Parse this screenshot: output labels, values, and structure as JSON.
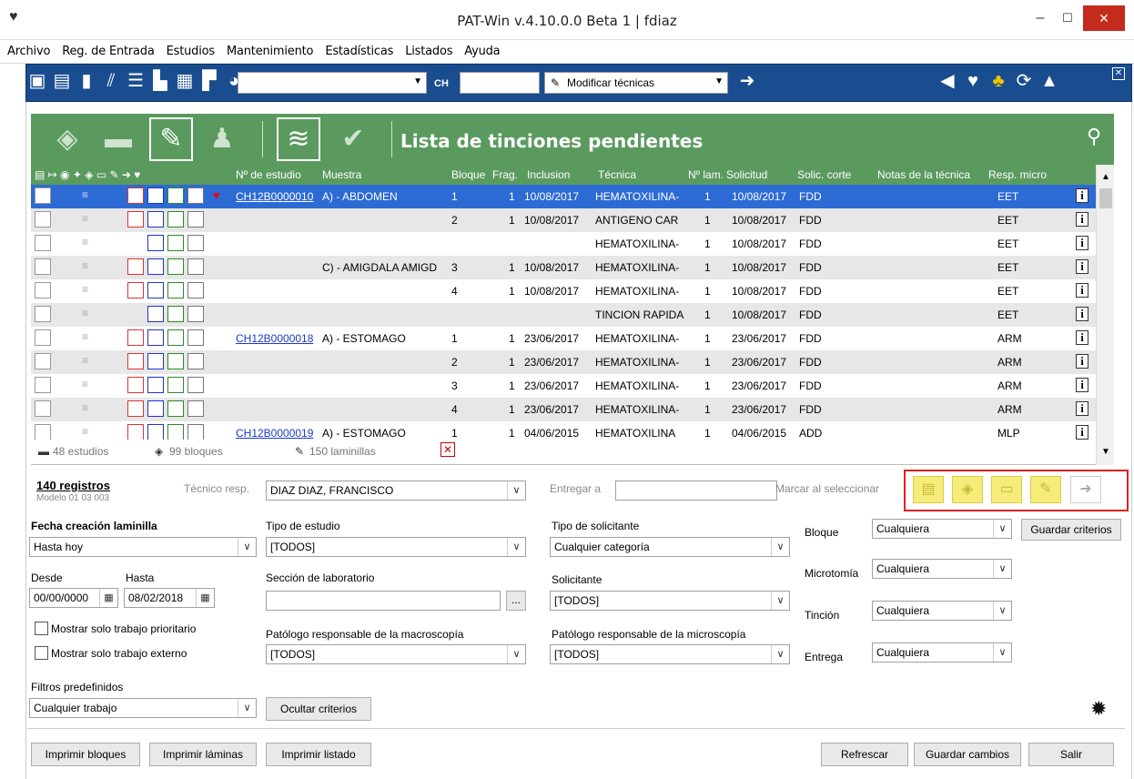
{
  "window": {
    "title": "PAT-Win v.4.10.0.0 Beta 1 | fdiaz",
    "minimize": "–",
    "maximize": "☐",
    "close": "✕"
  },
  "menu": [
    "Archivo",
    "Reg. de Entrada",
    "Estudios",
    "Mantenimiento",
    "Estadísticas",
    "Listados",
    "Ayuda"
  ],
  "toolbar": {
    "ch_label": "CH",
    "action_select": "Modificar técnicas"
  },
  "header": {
    "title": "Lista de tinciones pendientes"
  },
  "grid": {
    "columns": [
      "Nº de estudio",
      "Muestra",
      "Bloque",
      "Frag.",
      "Inclusion",
      "Técnica",
      "Nº lam.",
      "Solicitud",
      "Solic. corte",
      "Notas de la técnica",
      "Resp. micro"
    ],
    "rows": [
      {
        "estudio": "CH12B0000010",
        "muestra": "A) - ABDOMEN",
        "bloque": "1",
        "frag": "1",
        "inclusion": "10/08/2017",
        "tecnica": "HEMATOXILINA-",
        "lam": "1",
        "solicitud": "10/08/2017",
        "corte": "FDD",
        "resp": "EET"
      },
      {
        "estudio": "",
        "muestra": "",
        "bloque": "2",
        "frag": "1",
        "inclusion": "10/08/2017",
        "tecnica": "ANTIGENO CAR",
        "lam": "1",
        "solicitud": "10/08/2017",
        "corte": "FDD",
        "resp": "EET"
      },
      {
        "estudio": "",
        "muestra": "",
        "bloque": "",
        "frag": "",
        "inclusion": "",
        "tecnica": "HEMATOXILINA-",
        "lam": "1",
        "solicitud": "10/08/2017",
        "corte": "FDD",
        "resp": "EET"
      },
      {
        "estudio": "",
        "muestra": "C) - AMIGDALA AMIGD",
        "bloque": "3",
        "frag": "1",
        "inclusion": "10/08/2017",
        "tecnica": "HEMATOXILINA-",
        "lam": "1",
        "solicitud": "10/08/2017",
        "corte": "FDD",
        "resp": "EET"
      },
      {
        "estudio": "",
        "muestra": "",
        "bloque": "4",
        "frag": "1",
        "inclusion": "10/08/2017",
        "tecnica": "HEMATOXILINA-",
        "lam": "1",
        "solicitud": "10/08/2017",
        "corte": "FDD",
        "resp": "EET"
      },
      {
        "estudio": "",
        "muestra": "",
        "bloque": "",
        "frag": "",
        "inclusion": "",
        "tecnica": "TINCION RAPIDA",
        "lam": "1",
        "solicitud": "10/08/2017",
        "corte": "FDD",
        "resp": "EET"
      },
      {
        "estudio": "CH12B0000018",
        "muestra": "A) - ESTOMAGO",
        "bloque": "1",
        "frag": "1",
        "inclusion": "23/06/2017",
        "tecnica": "HEMATOXILINA-",
        "lam": "1",
        "solicitud": "23/06/2017",
        "corte": "FDD",
        "resp": "ARM"
      },
      {
        "estudio": "",
        "muestra": "",
        "bloque": "2",
        "frag": "1",
        "inclusion": "23/06/2017",
        "tecnica": "HEMATOXILINA-",
        "lam": "1",
        "solicitud": "23/06/2017",
        "corte": "FDD",
        "resp": "ARM"
      },
      {
        "estudio": "",
        "muestra": "",
        "bloque": "3",
        "frag": "1",
        "inclusion": "23/06/2017",
        "tecnica": "HEMATOXILINA-",
        "lam": "1",
        "solicitud": "23/06/2017",
        "corte": "FDD",
        "resp": "ARM"
      },
      {
        "estudio": "",
        "muestra": "",
        "bloque": "4",
        "frag": "1",
        "inclusion": "23/06/2017",
        "tecnica": "HEMATOXILINA-",
        "lam": "1",
        "solicitud": "23/06/2017",
        "corte": "FDD",
        "resp": "ARM"
      },
      {
        "estudio": "CH12B0000019",
        "muestra": "A) - ESTOMAGO",
        "bloque": "1",
        "frag": "1",
        "inclusion": "04/06/2015",
        "tecnica": "HEMATOXILINA",
        "lam": "1",
        "solicitud": "04/06/2015",
        "corte": "ADD",
        "resp": "MLP"
      }
    ]
  },
  "summary": {
    "estudios": "48 estudios",
    "bloques": "99 bloques",
    "laminillas": "150 laminillas"
  },
  "records": {
    "count": "140 registros",
    "model": "Modelo 01 03 003"
  },
  "tecnico": {
    "label": "Técnico resp.",
    "value": "DIAZ DIAZ, FRANCISCO"
  },
  "entregar": {
    "label": "Entregar a",
    "value": ""
  },
  "marcar": {
    "label": "Marcar al seleccionar"
  },
  "filters": {
    "fecha_label": "Fecha creación laminilla",
    "fecha_value": "Hasta hoy",
    "desde_label": "Desde",
    "desde_value": "00/00/0000",
    "hasta_label": "Hasta",
    "hasta_value": "08/02/2018",
    "prioritario": "Mostrar solo trabajo prioritario",
    "externo": "Mostrar solo trabajo externo",
    "predef_label": "Filtros predefinidos",
    "predef_value": "Cualquier trabajo",
    "tipo_estudio_label": "Tipo de estudio",
    "tipo_estudio_value": "[TODOS]",
    "seccion_label": "Sección de laboratorio",
    "seccion_value": "",
    "pat_macro_label": "Patólogo responsable de la macroscopía",
    "pat_macro_value": "[TODOS]",
    "tipo_sol_label": "Tipo de solicitante",
    "tipo_sol_value": "Cualquier categoría",
    "solicitante_label": "Solicitante",
    "solicitante_value": "[TODOS]",
    "pat_micro_label": "Patólogo responsable de la microscopía",
    "pat_micro_value": "[TODOS]",
    "bloque_label": "Bloque",
    "bloque_value": "Cualquiera",
    "microtomia_label": "Microtomía",
    "microtomia_value": "Cualquiera",
    "tincion_label": "Tinción",
    "tincion_value": "Cualquiera",
    "entrega_label": "Entrega",
    "entrega_value": "Cualquiera"
  },
  "buttons": {
    "guardar_criterios": "Guardar criterios",
    "ocultar_criterios": "Ocultar criterios",
    "imprimir_bloques": "Imprimir bloques",
    "imprimir_laminas": "Imprimir láminas",
    "imprimir_listado": "Imprimir listado",
    "refrescar": "Refrescar",
    "guardar_cambios": "Guardar cambios",
    "salir": "Salir",
    "ellipsis": "..."
  },
  "colors": {
    "toolbar": "#1a4d8f",
    "header_green": "#5a9a5e",
    "selection": "#2d6bd4",
    "highlight_box": "#e02020",
    "yellow_btn": "#f6ec7a"
  }
}
